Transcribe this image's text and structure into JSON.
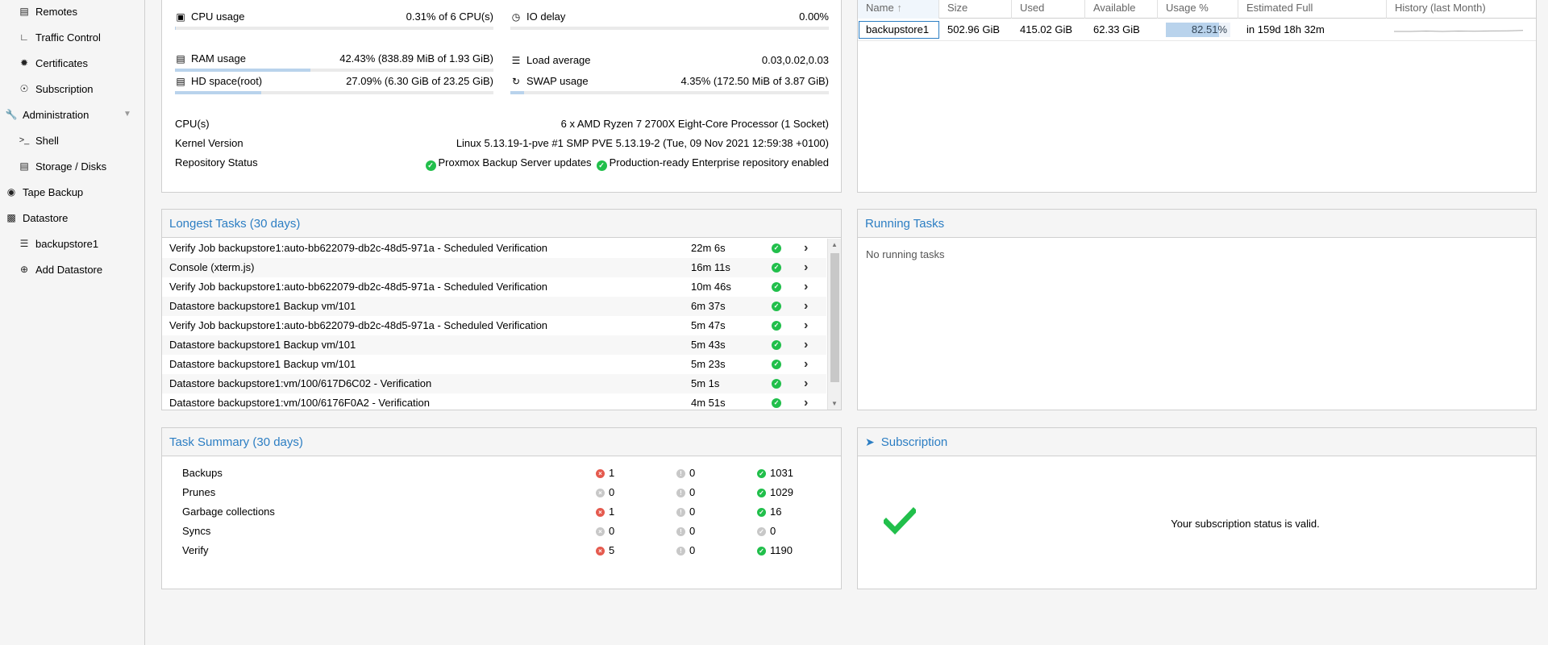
{
  "sidebar": {
    "items": [
      {
        "label": "Remotes",
        "icon": "server-icon"
      },
      {
        "label": "Traffic Control",
        "icon": "traffic-icon"
      },
      {
        "label": "Certificates",
        "icon": "certificate-icon"
      },
      {
        "label": "Subscription",
        "icon": "support-icon"
      },
      {
        "label": "Administration",
        "icon": "wrench-icon"
      },
      {
        "label": "Shell",
        "icon": "terminal-icon"
      },
      {
        "label": "Storage / Disks",
        "icon": "disk-icon"
      },
      {
        "label": "Tape Backup",
        "icon": "tape-icon"
      },
      {
        "label": "Datastore",
        "icon": "archive-icon"
      },
      {
        "label": "backupstore1",
        "icon": "database-icon"
      },
      {
        "label": "Add Datastore",
        "icon": "plus-circle-icon"
      }
    ]
  },
  "status": {
    "cpu": {
      "label": "CPU usage",
      "value": "0.31% of 6 CPU(s)",
      "usage": 0.0031
    },
    "io": {
      "label": "IO delay",
      "value": "0.00%",
      "usage": 0.0
    },
    "ram": {
      "label": "RAM usage",
      "value": "42.43% (838.89 MiB of 1.93 GiB)",
      "usage": 0.4243
    },
    "load": {
      "label": "Load average",
      "value": "0.03,0.02,0.03"
    },
    "hd": {
      "label": "HD space(root)",
      "value": "27.09% (6.30 GiB of 23.25 GiB)",
      "usage": 0.2709
    },
    "swap": {
      "label": "SWAP usage",
      "value": "4.35% (172.50 MiB of 3.87 GiB)",
      "usage": 0.0435
    },
    "cpus_label": "CPU(s)",
    "cpus_value": "6 x AMD Ryzen 7 2700X Eight-Core Processor (1 Socket)",
    "kernel_label": "Kernel Version",
    "kernel_value": "Linux 5.13.19-1-pve #1 SMP PVE 5.13.19-2 (Tue, 09 Nov 2021 12:59:38 +0100)",
    "repo_label": "Repository Status",
    "repo_status_1": "Proxmox Backup Server updates",
    "repo_status_2": "Production-ready Enterprise repository enabled"
  },
  "datastore_grid": {
    "headers": [
      "Name",
      "Size",
      "Used",
      "Available",
      "Usage %",
      "Estimated Full",
      "History (last Month)"
    ],
    "sort_indicator": "↑",
    "row": {
      "name": "backupstore1",
      "size": "502.96 GiB",
      "used": "415.02 GiB",
      "available": "62.33 GiB",
      "usage": "82.51%",
      "usage_fraction": 0.8251,
      "estimated_full": "in 159d 18h 32m"
    }
  },
  "longest_tasks": {
    "title": "Longest Tasks (30 days)",
    "rows": [
      {
        "name": "Verify Job backupstore1:auto-bb622079-db2c-48d5-971a - Scheduled Verification",
        "duration": "22m 6s"
      },
      {
        "name": "Console (xterm.js)",
        "duration": "16m 11s"
      },
      {
        "name": "Verify Job backupstore1:auto-bb622079-db2c-48d5-971a - Scheduled Verification",
        "duration": "10m 46s"
      },
      {
        "name": "Datastore backupstore1 Backup vm/101",
        "duration": "6m 37s"
      },
      {
        "name": "Verify Job backupstore1:auto-bb622079-db2c-48d5-971a - Scheduled Verification",
        "duration": "5m 47s"
      },
      {
        "name": "Datastore backupstore1 Backup vm/101",
        "duration": "5m 43s"
      },
      {
        "name": "Datastore backupstore1 Backup vm/101",
        "duration": "5m 23s"
      },
      {
        "name": "Datastore backupstore1:vm/100/617D6C02 - Verification",
        "duration": "5m 1s"
      },
      {
        "name": "Datastore backupstore1:vm/100/6176F0A2 - Verification",
        "duration": "4m 51s"
      }
    ]
  },
  "running_tasks": {
    "title": "Running Tasks",
    "empty_text": "No running tasks"
  },
  "task_summary": {
    "title": "Task Summary (30 days)",
    "rows": [
      {
        "label": "Backups",
        "error": "1",
        "warning": "0",
        "ok": "1031",
        "error_active": true,
        "ok_active": true
      },
      {
        "label": "Prunes",
        "error": "0",
        "warning": "0",
        "ok": "1029",
        "error_active": false,
        "ok_active": true
      },
      {
        "label": "Garbage collections",
        "error": "1",
        "warning": "0",
        "ok": "16",
        "error_active": true,
        "ok_active": true
      },
      {
        "label": "Syncs",
        "error": "0",
        "warning": "0",
        "ok": "0",
        "error_active": false,
        "ok_active": false
      },
      {
        "label": "Verify",
        "error": "5",
        "warning": "0",
        "ok": "1190",
        "error_active": true,
        "ok_active": true
      }
    ]
  },
  "subscription": {
    "title": "Subscription",
    "status_text": "Your subscription status is valid."
  },
  "colors": {
    "accent": "#2c7ec3",
    "ok": "#21bf4b",
    "error": "#e55a4e",
    "bar": "#b9d3ec"
  }
}
